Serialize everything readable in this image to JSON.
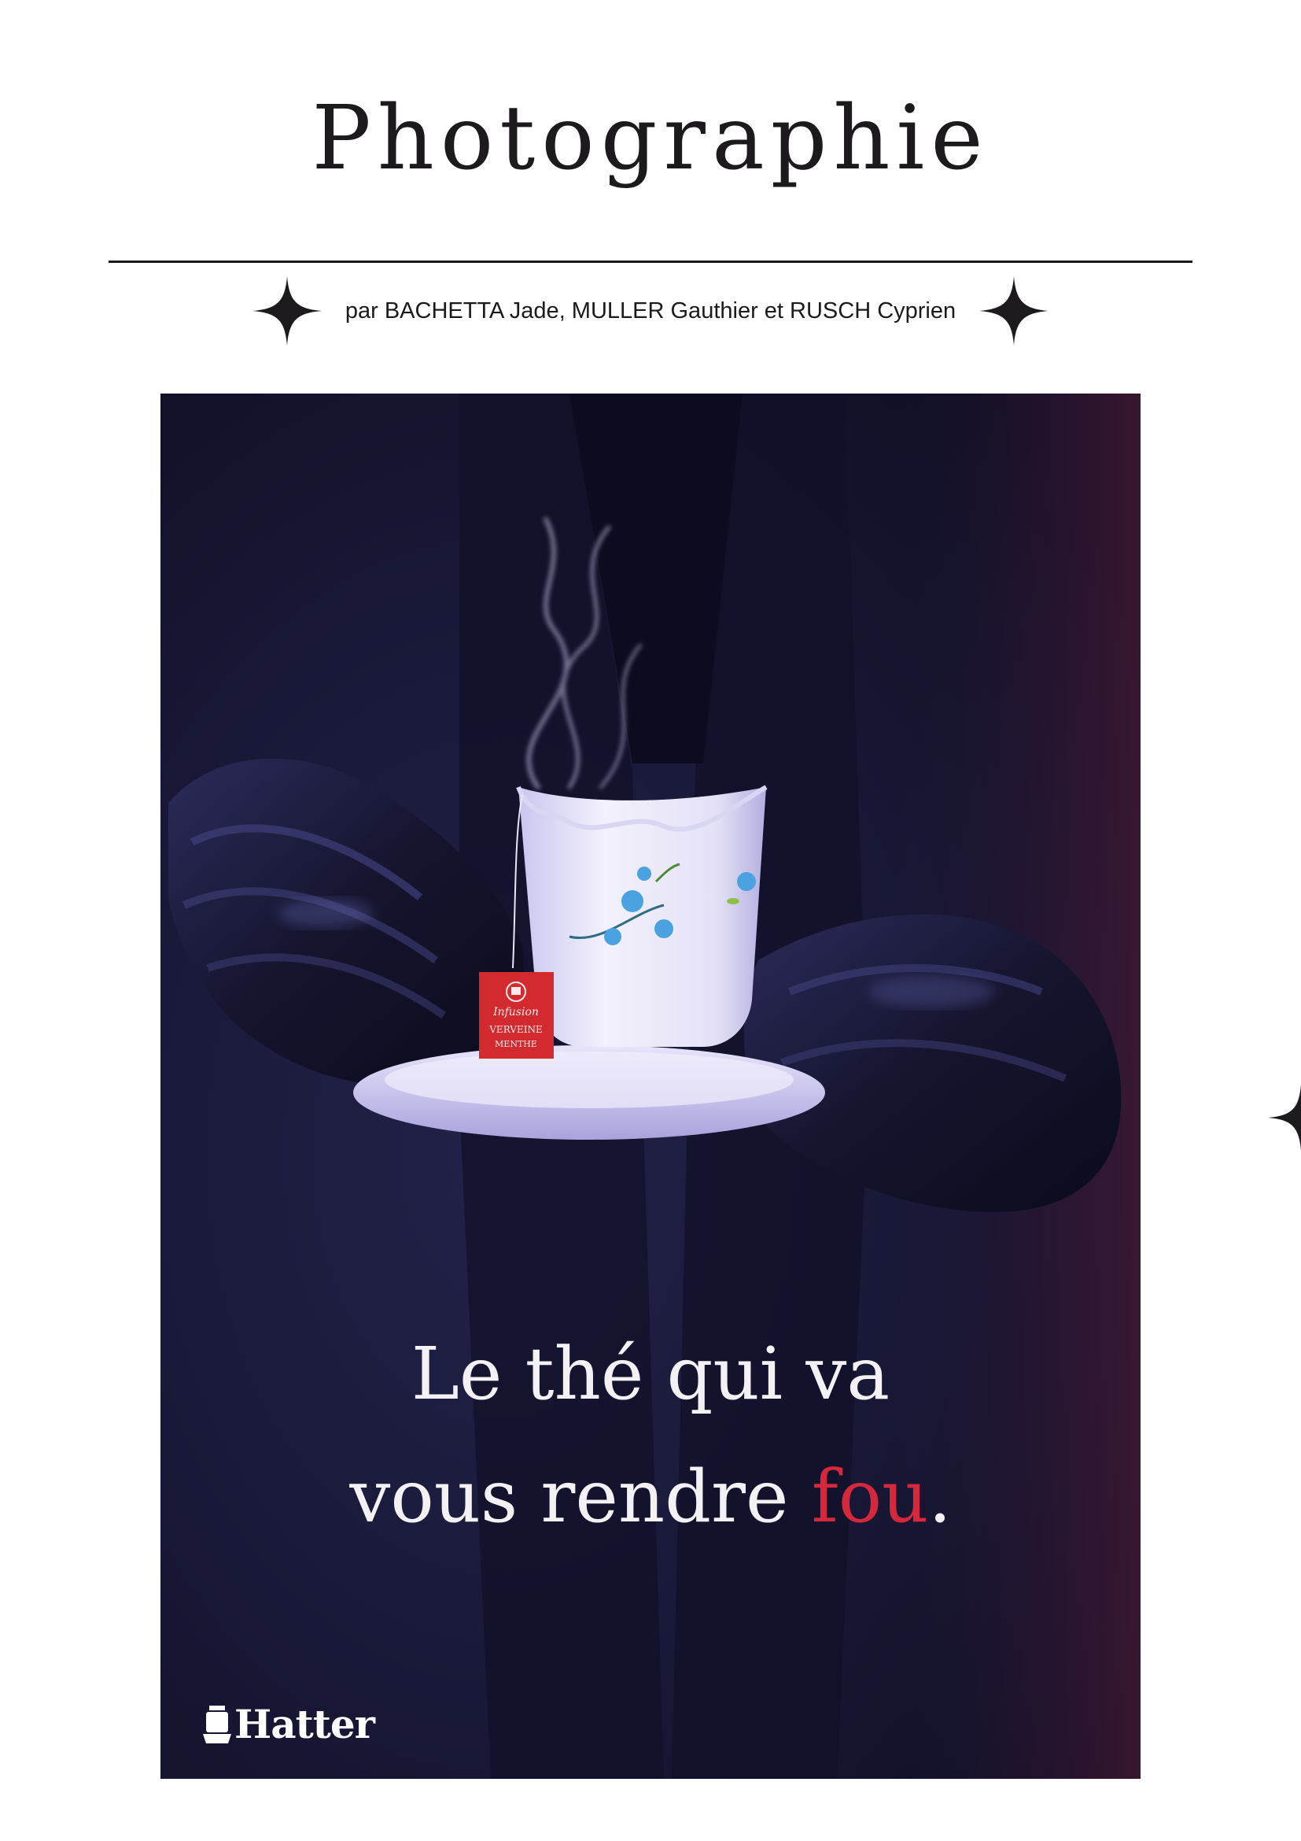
{
  "header": {
    "title": "Photographie",
    "byline": "par BACHETTA Jade, MULLER Gauthier et RUSCH Cyprien"
  },
  "poster": {
    "tagline_line1": "Le thé qui va",
    "tagline_line2_main": "vous rendre ",
    "tagline_line2_accent": "fou",
    "tagline_line2_end": ".",
    "brand": "Hatter",
    "teabag": {
      "line1": "Infusion",
      "line2": "VERVEINE",
      "line3": "MENTHE"
    }
  },
  "colors": {
    "ink": "#1c1a1d",
    "poster_background": "#151531",
    "accent_red": "#d6283c",
    "text_light": "#f4f1f4"
  },
  "icons": [
    "sparkle-star-icon",
    "teacup-brand-icon"
  ]
}
